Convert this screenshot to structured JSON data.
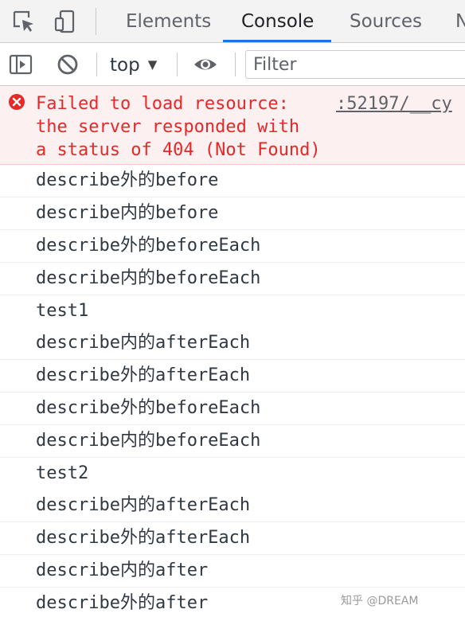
{
  "tabs": [
    "Elements",
    "Console",
    "Sources",
    "N"
  ],
  "toolbar": {
    "context": "top",
    "filter_placeholder": "Filter"
  },
  "error": {
    "message": "Failed to load resource:\nthe server responded with\na status of 404 (Not Found)",
    "source": ":52197/__cy"
  },
  "logs": [
    "describe外的before",
    "describe内的before",
    "describe外的beforeEach",
    "describe内的beforeEach",
    "test1",
    "describe内的afterEach",
    "describe外的afterEach",
    "describe外的beforeEach",
    "describe内的beforeEach",
    "test2",
    "describe内的afterEach",
    "describe外的afterEach",
    "describe内的after",
    "describe外的after"
  ],
  "watermark": "知乎 @DREAM",
  "colors": {
    "error_text": "#e52828",
    "error_bg": "#fdf0f0",
    "active_tab_underline": "#1a73e8"
  }
}
